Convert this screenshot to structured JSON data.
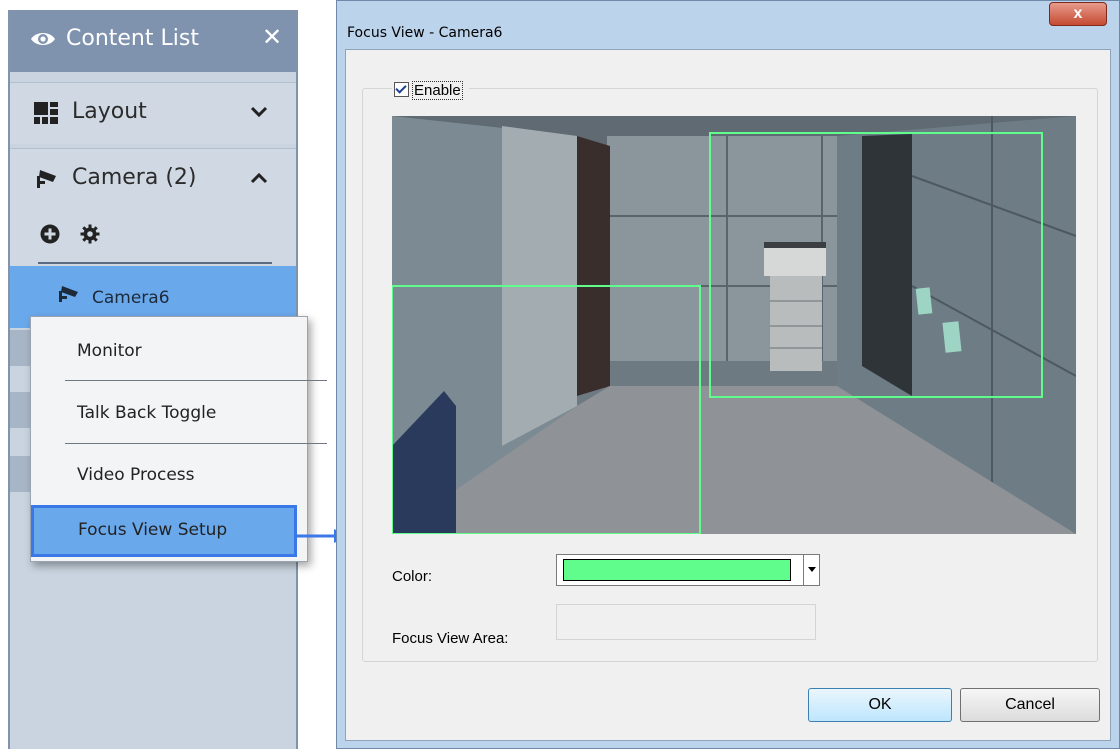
{
  "content_list": {
    "title": "Content List",
    "close_glyph": "✕",
    "sections": {
      "layout": {
        "label": "Layout",
        "state": "collapsed"
      },
      "camera": {
        "label": "Camera (2)",
        "state": "expanded"
      }
    },
    "selected_camera": {
      "label": "Camera6"
    }
  },
  "context_menu": {
    "items": [
      {
        "label": "Monitor"
      },
      {
        "label": "Talk Back Toggle"
      },
      {
        "label": "Video Process"
      },
      {
        "label": "Focus View Setup",
        "highlighted": true
      }
    ]
  },
  "dialog": {
    "title": "Focus View - Camera6",
    "close_glyph": "x",
    "enable": {
      "label": "Enable",
      "checked": true
    },
    "color_label": "Color:",
    "color_value": "#60fc8c",
    "area_label": "Focus View Area:",
    "area_value": "",
    "ok_label": "OK",
    "cancel_label": "Cancel"
  },
  "colors": {
    "panel_header": "#7f93ae",
    "selection": "#6aa8ec",
    "highlight_border": "#3a78e8",
    "focus_rect": "#60fc8c"
  }
}
